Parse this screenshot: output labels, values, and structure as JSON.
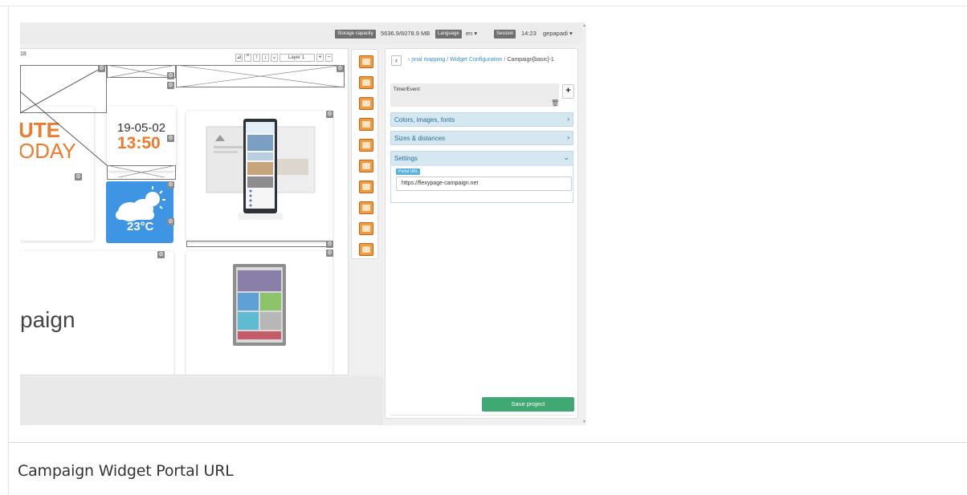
{
  "topbar": {
    "storage_label": "Storage capacity",
    "storage_value": "5636.9/6078.9 MB",
    "language_label": "Language",
    "language_value": "en ▾",
    "session_label": "Session",
    "session_value": "14:23",
    "user": "gepapadi ▾"
  },
  "canvas": {
    "page_label": "18",
    "layer_select": "Layer 1",
    "minute_text": "UTE",
    "today_text": "ODAY",
    "date": "19-05-02",
    "time": "13:50",
    "temperature": "23°C",
    "campaign_partial": "paign"
  },
  "panel": {
    "breadcrumb_1": "ɲnal mapping",
    "breadcrumb_2": "Widget Configuration",
    "breadcrumb_3": "Campaign[basic]-1",
    "timer_label": "Timer/Event:",
    "sections": {
      "colors": "Colors, images, fonts",
      "sizes": "Sizes & distances",
      "settings": "Settings"
    },
    "portal_url_label": "Portal URL",
    "portal_url_value": "https://flexypage-campaign.net",
    "save_label": "Save project"
  },
  "caption": "Campaign Widget Portal URL",
  "colors": {
    "accent_orange": "#f07a2c",
    "save_green": "#3fa873",
    "weather_blue": "#3d95e3",
    "link_blue": "#3a8ec5"
  }
}
